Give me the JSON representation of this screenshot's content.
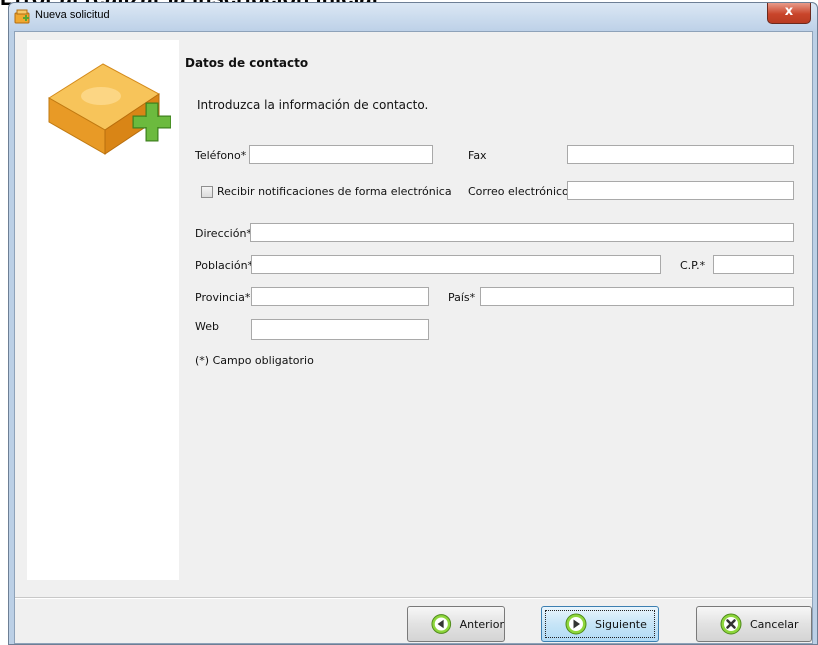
{
  "background": {
    "caption": "Error al realizar la inscripción inicial"
  },
  "window": {
    "title": "Nueva solicitud",
    "close_label": "x"
  },
  "form": {
    "section_title": "Datos de contacto",
    "intro": "Introduzca la información de contacto.",
    "telefono": {
      "label": "Teléfono*",
      "value": ""
    },
    "fax": {
      "label": "Fax",
      "value": ""
    },
    "notificaciones": {
      "label": "Recibir notificaciones de forma electrónica",
      "checked": false
    },
    "correo": {
      "label": "Correo electrónico*",
      "value": ""
    },
    "direccion": {
      "label": "Dirección*",
      "value": ""
    },
    "poblacion": {
      "label": "Población*",
      "value": ""
    },
    "cp": {
      "label": "C.P.*",
      "value": ""
    },
    "provincia": {
      "label": "Provincia*",
      "value": ""
    },
    "pais": {
      "label": "País*",
      "value": ""
    },
    "web": {
      "label": "Web",
      "value": ""
    },
    "required_note": "(*) Campo obligatorio"
  },
  "buttons": {
    "anterior": "Anterior",
    "siguiente": "Siguiente",
    "cancelar": "Cancelar"
  },
  "colors": {
    "box_orange": "#f0a830",
    "plus_green": "#5aa531",
    "close_red": "#c9452b"
  }
}
